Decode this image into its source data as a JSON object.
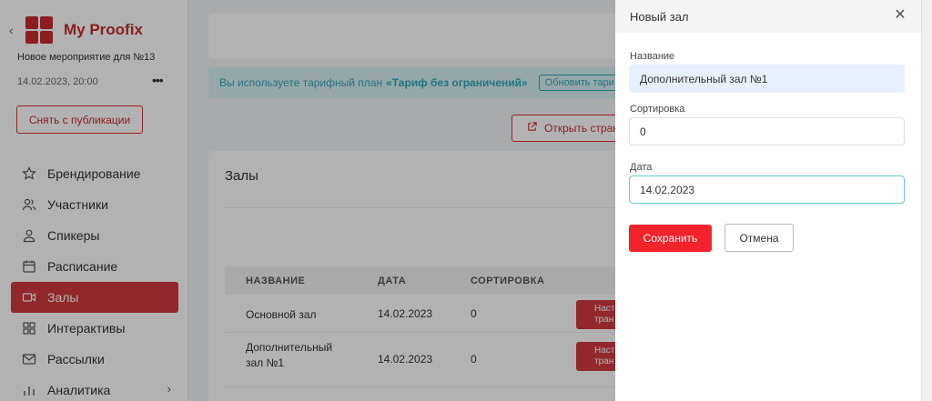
{
  "sidebar": {
    "app_title": "My Proofix",
    "event_name": "Новое мероприятие для №13",
    "event_date": "14.02.2023, 20:00",
    "more": "•••",
    "unpublish_button": "Снять с публикации",
    "items": [
      {
        "label": "Брендирование",
        "icon": "star-icon"
      },
      {
        "label": "Участники",
        "icon": "users-icon"
      },
      {
        "label": "Спикеры",
        "icon": "user-icon"
      },
      {
        "label": "Расписание",
        "icon": "calendar-icon"
      },
      {
        "label": "Залы",
        "icon": "video-icon",
        "active": true
      },
      {
        "label": "Интерактивы",
        "icon": "grid-icon"
      },
      {
        "label": "Рассылки",
        "icon": "mail-icon"
      },
      {
        "label": "Аналитика",
        "icon": "chart-icon"
      }
    ]
  },
  "plan_bar": {
    "text": "Вы используете тарифный план",
    "plan_name": "«Тариф без ограничений»",
    "button": "Обновить тари"
  },
  "open_page_button": "Открыть стран",
  "halls": {
    "title": "Залы",
    "columns": [
      "НАЗВАНИЕ",
      "ДАТА",
      "СОРТИРОВКА"
    ],
    "rows": [
      {
        "name": "Основной зал",
        "date": "14.02.2023",
        "sort": "0",
        "action": "Наст\nтран"
      },
      {
        "name": "Дополнительный зал №1",
        "date": "14.02.2023",
        "sort": "0",
        "action": "Наст\nтран"
      }
    ]
  },
  "panel": {
    "title": "Новый зал",
    "name_label": "Название",
    "name_value": "Дополнительный зал №1",
    "sort_label": "Сортировка",
    "sort_value": "0",
    "date_label": "Дата",
    "date_value": "14.02.2023",
    "save_button": "Сохранить",
    "cancel_button": "Отмена"
  },
  "colors": {
    "brand": "#c62b2f",
    "active_nav": "#d13a3e",
    "save": "#f1232b",
    "plan_bg": "#d6f0f3",
    "plan_text": "#2ea7b5"
  }
}
